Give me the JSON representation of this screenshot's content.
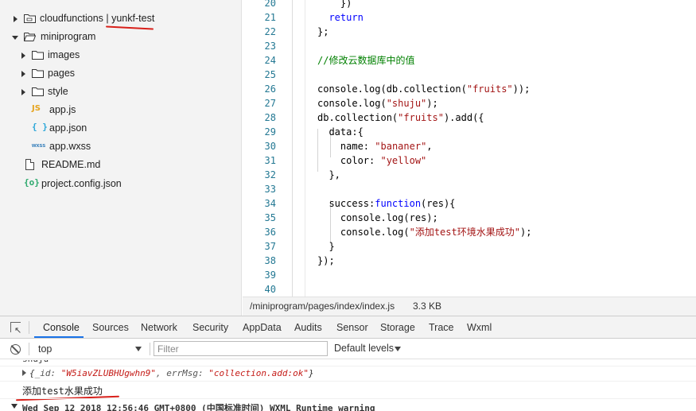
{
  "file_tree": {
    "cloudfunctions_label": "cloudfunctions | ",
    "cloudfunctions_env": "yunkf-test",
    "miniprogram": "miniprogram",
    "images": "images",
    "pages": "pages",
    "style": "style",
    "app_js": "app.js",
    "app_json": "app.json",
    "app_wxss": "app.wxss",
    "readme": "README.md",
    "project_config": "project.config.json",
    "icons": {
      "js": "JS",
      "json": "{ }",
      "wxss": "wxss",
      "config": "{o}"
    }
  },
  "editor": {
    "line_numbers": [
      "20",
      "21",
      "22",
      "23",
      "24",
      "25",
      "26",
      "27",
      "28",
      "29",
      "30",
      "31",
      "32",
      "33",
      "34",
      "35",
      "36",
      "37",
      "38",
      "39",
      "40"
    ],
    "l20": "})",
    "l21_kw": "return",
    "l22": "};",
    "l24_comment": "//修改云数据库中的值",
    "l26_a": "console.log(db.collection(",
    "l26_s": "\"fruits\"",
    "l26_b": "));",
    "l27_a": "console.log(",
    "l27_s": "\"shuju\"",
    "l27_b": ");",
    "l28_a": "db.collection(",
    "l28_s": "\"fruits\"",
    "l28_b": ").add({",
    "l29": "data:{",
    "l30_k": "name: ",
    "l30_s": "\"bananer\"",
    "l30_b": ",",
    "l31_k": "color: ",
    "l31_s": "\"yellow\"",
    "l32": "},",
    "l34_a": "success:",
    "l34_kw": "function",
    "l34_b": "(res){",
    "l35": "console.log(res);",
    "l36_a": "console.log(",
    "l36_s": "\"添加test环境水果成功\"",
    "l36_b": ");",
    "l37": "}",
    "l38": "});"
  },
  "status": {
    "path": "/miniprogram/pages/index/index.js",
    "size": "3.3 KB"
  },
  "devtools": {
    "tabs": [
      "Console",
      "Sources",
      "Network",
      "Security",
      "AppData",
      "Audits",
      "Sensor",
      "Storage",
      "Trace",
      "Wxml"
    ],
    "active_tab": "Console",
    "context": "top",
    "filter_placeholder": "Filter",
    "levels": "Default levels",
    "console": {
      "line0": "shuju",
      "obj_open": "{",
      "obj_k1": "_id: ",
      "obj_v1": "\"W5iavZLUBHUgwhn9\"",
      "obj_k2": ", errMsg: ",
      "obj_v2": "\"collection.add:ok\"",
      "obj_close": "}",
      "success_msg": "添加test水果成功",
      "warning": "Wed Sep 12 2018 12:56:46 GMT+0800 (中国标准时间) WXML Runtime warning"
    }
  },
  "colors": {
    "keyword": "#0000ff",
    "string": "#a31515",
    "comment": "#008000",
    "line_number": "#237893",
    "annotation_red": "#d8201a",
    "tab_underline": "#1a73e8"
  }
}
